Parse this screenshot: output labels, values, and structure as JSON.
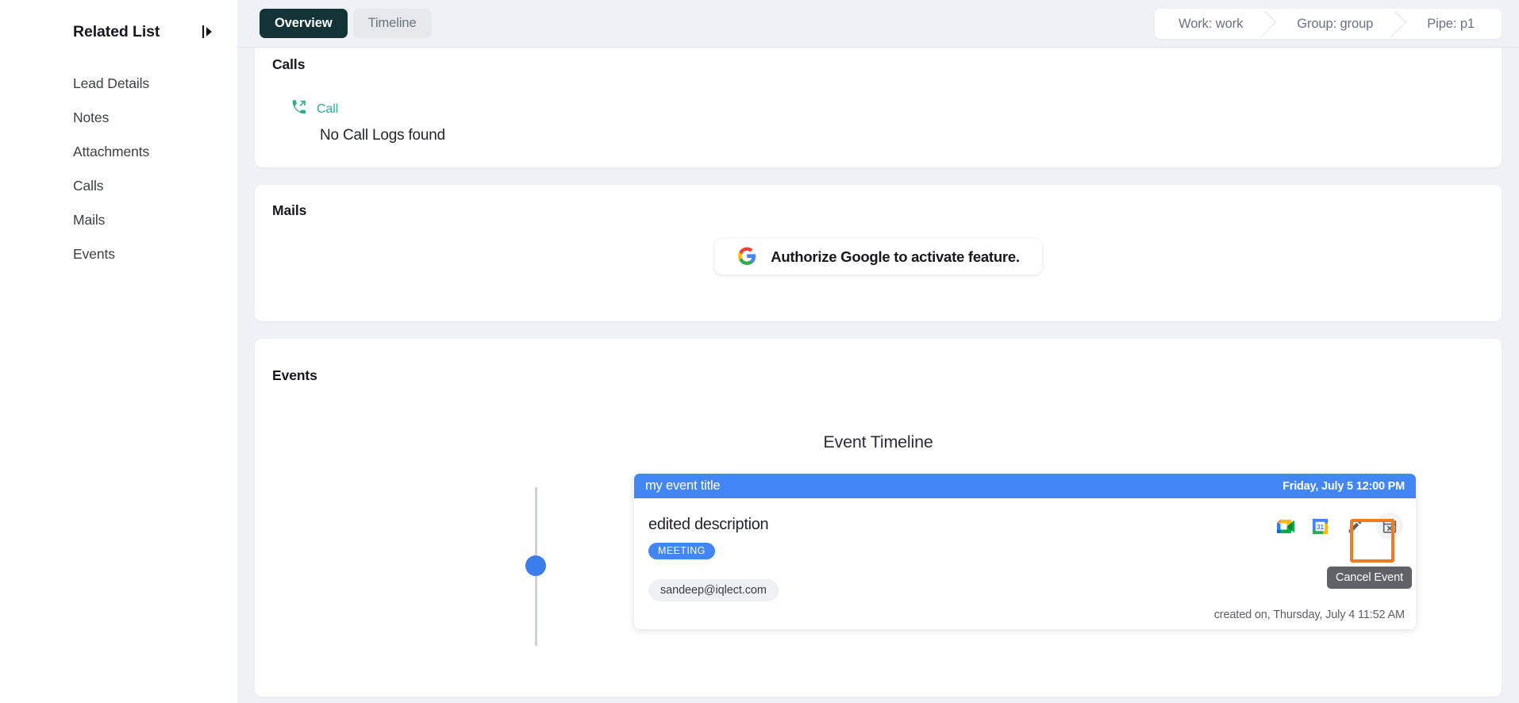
{
  "sidebar": {
    "title": "Related List",
    "collapse_icon": "panel-expand-icon",
    "items": [
      {
        "label": "Lead Details",
        "name": "lead-details"
      },
      {
        "label": "Notes",
        "name": "notes"
      },
      {
        "label": "Attachments",
        "name": "attachments"
      },
      {
        "label": "Calls",
        "name": "calls"
      },
      {
        "label": "Mails",
        "name": "mails"
      },
      {
        "label": "Events",
        "name": "events"
      }
    ]
  },
  "topbar": {
    "tabs": [
      {
        "label": "Overview",
        "active": true
      },
      {
        "label": "Timeline",
        "active": false
      }
    ],
    "breadcrumb": [
      {
        "label": "Work: work"
      },
      {
        "label": "Group: group"
      },
      {
        "label": "Pipe: p1"
      }
    ]
  },
  "calls": {
    "title": "Calls",
    "call_link_label": "Call",
    "call_icon": "phone-outgoing-icon",
    "empty_message": "No Call Logs found"
  },
  "mails": {
    "title": "Mails",
    "authorize_label": "Authorize Google to activate feature.",
    "google_icon": "google-g-icon"
  },
  "events": {
    "title": "Events",
    "timeline_heading": "Event Timeline",
    "event": {
      "title": "my event title",
      "date": "Friday, July 5 12:00 PM",
      "description": "edited description",
      "badge": "MEETING",
      "attendee": "sandeep@iqlect.com",
      "created_on": "created on, Thursday, July 4 11:52 AM",
      "actions": [
        {
          "name": "google-meet-icon",
          "label": "Google Meet"
        },
        {
          "name": "google-calendar-icon",
          "label": "Google Calendar"
        },
        {
          "name": "pencil-edit-icon",
          "label": "Edit Event"
        },
        {
          "name": "calendar-cancel-icon",
          "label": "Cancel Event"
        }
      ],
      "tooltip": "Cancel Event"
    }
  },
  "colors": {
    "accent_dark": "#123436",
    "event_blue": "#4285f4",
    "teal": "#2eab94",
    "highlight_orange": "#f07c1e",
    "tooltip_gray": "#5f6368",
    "page_bg": "#eef1f5"
  }
}
